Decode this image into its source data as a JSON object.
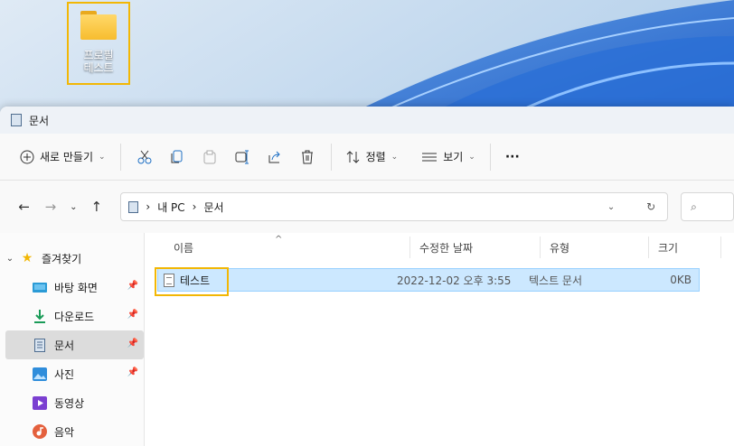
{
  "desktop": {
    "icon_label_line1": "프로필",
    "icon_label_line2": "테스트",
    "highlight_color": "#f2b705"
  },
  "window": {
    "title": "문서"
  },
  "toolbar": {
    "new_label": "새로 만들기",
    "sort_label": "정렬",
    "view_label": "보기",
    "more_label": "···",
    "icons": [
      "cut-icon",
      "copy-icon",
      "paste-icon",
      "rename-icon",
      "share-icon",
      "delete-icon"
    ]
  },
  "address": {
    "crumb1": "내 PC",
    "crumb2": "문서",
    "search_glyph": "⌕"
  },
  "sidebar": {
    "items": [
      {
        "label": "즐겨찾기",
        "icon": "star-icon"
      },
      {
        "label": "바탕 화면",
        "icon": "desktop-icon"
      },
      {
        "label": "다운로드",
        "icon": "download-icon"
      },
      {
        "label": "문서",
        "icon": "documents-icon"
      },
      {
        "label": "사진",
        "icon": "pictures-icon"
      },
      {
        "label": "동영상",
        "icon": "videos-icon"
      },
      {
        "label": "음악",
        "icon": "music-icon"
      }
    ]
  },
  "columns": {
    "name": "이름",
    "date": "수정한 날짜",
    "type": "유형",
    "size": "크기"
  },
  "files": [
    {
      "name": "테스트",
      "date": "2022-12-02 오후 3:55",
      "type": "텍스트 문서",
      "size": "0KB"
    }
  ]
}
